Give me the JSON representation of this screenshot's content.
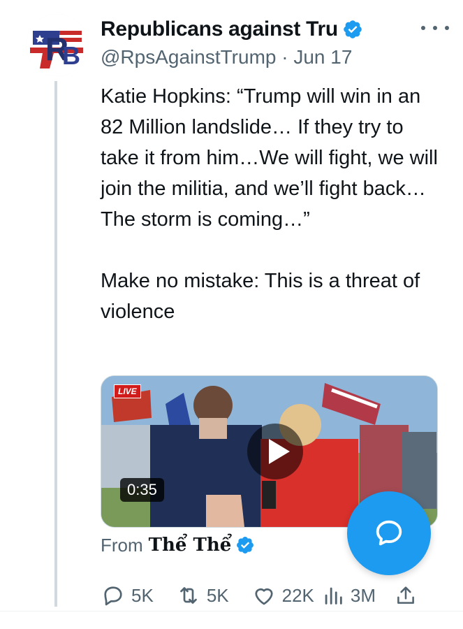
{
  "tweet": {
    "display_name": "Republicans against Tru",
    "handle": "@RpsAgainstTrump",
    "separator": "·",
    "date": "Jun 17",
    "text": "Katie Hopkins: “Trump will win in an 82 Million landslide… If they try to take it from him…We will fight, we will join the militia, and we’ll fight back… The storm is coming…”\n\nMake no mistake: This is a threat of violence",
    "avatar_letters": "RB"
  },
  "media": {
    "live_label": "LIVE",
    "duration": "0:35"
  },
  "attribution": {
    "from_label": "From",
    "source_name": "Thể Thể"
  },
  "actions": {
    "replies": "5K",
    "reposts": "5K",
    "likes": "22K",
    "views": "3M"
  },
  "colors": {
    "accent": "#1d9bf0",
    "secondary_text": "#536471",
    "thread_line": "#cfd9de"
  }
}
